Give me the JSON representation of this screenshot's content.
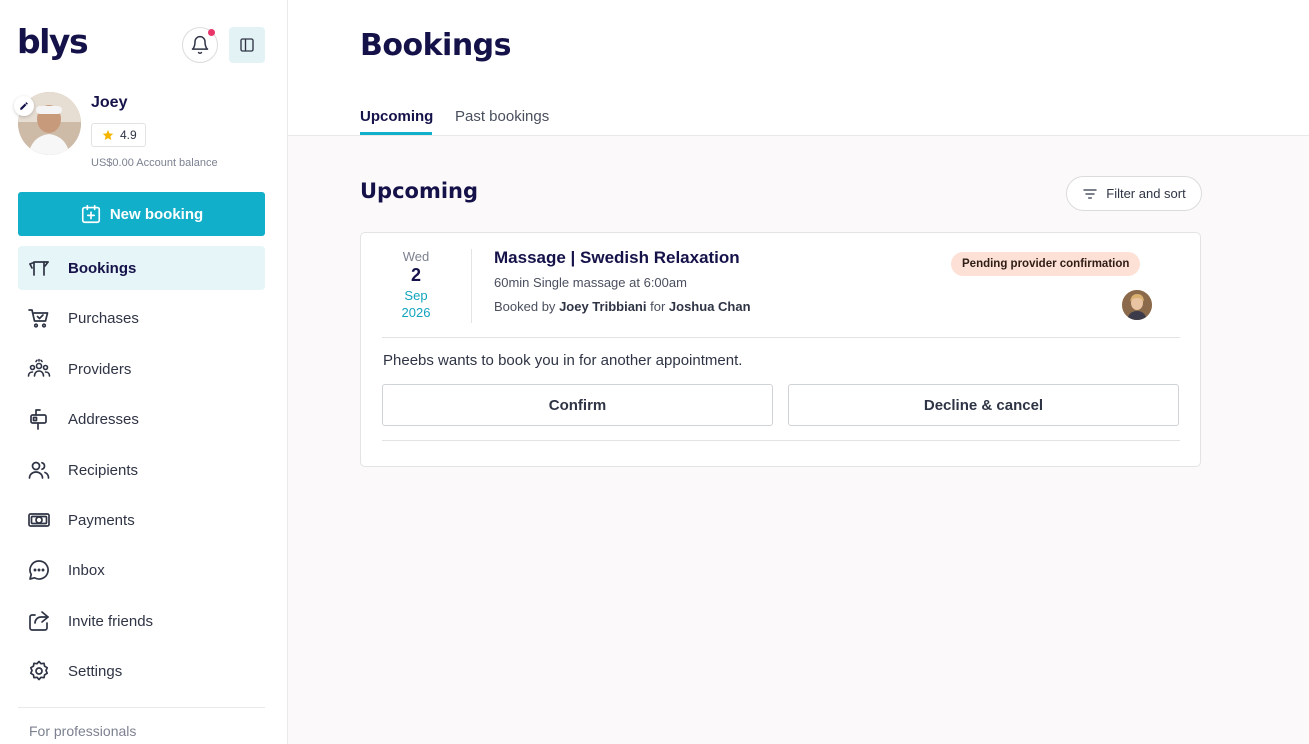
{
  "app": {
    "logo": "blys"
  },
  "user": {
    "name": "Joey",
    "rating": "4.9",
    "balance": "US$0.00 Account balance"
  },
  "sidebar": {
    "new_booking_label": "New booking",
    "items": [
      {
        "label": "Bookings",
        "icon": "bookings-icon",
        "active": true
      },
      {
        "label": "Purchases",
        "icon": "cart-icon"
      },
      {
        "label": "Providers",
        "icon": "providers-icon"
      },
      {
        "label": "Addresses",
        "icon": "mailbox-icon"
      },
      {
        "label": "Recipients",
        "icon": "recipients-icon"
      },
      {
        "label": "Payments",
        "icon": "payments-icon"
      },
      {
        "label": "Inbox",
        "icon": "chat-icon"
      },
      {
        "label": "Invite friends",
        "icon": "share-icon"
      },
      {
        "label": "Settings",
        "icon": "gear-icon"
      }
    ],
    "for_professionals": "For professionals"
  },
  "main": {
    "title": "Bookings",
    "tabs": [
      {
        "label": "Upcoming",
        "active": true
      },
      {
        "label": "Past bookings",
        "active": false
      }
    ],
    "section_title": "Upcoming",
    "filter_label": "Filter and sort"
  },
  "booking": {
    "date": {
      "dow": "Wed",
      "day": "2",
      "month": "Sep",
      "year": "2026"
    },
    "title": "Massage | Swedish Relaxation",
    "detail": "60min Single massage at 6:00am",
    "booked_prefix": "Booked by",
    "booked_by": "Joey Tribbiani",
    "for_word": "for",
    "recipient": "Joshua Chan",
    "status": "Pending provider confirmation",
    "message": "Pheebs wants to book you in for another appointment.",
    "confirm_label": "Confirm",
    "decline_label": "Decline & cancel"
  },
  "colors": {
    "accent": "#11afc9",
    "navy": "#15124a",
    "badge_bg": "#fde1d6",
    "notification_dot": "#e8356a",
    "star": "#f5b400"
  }
}
